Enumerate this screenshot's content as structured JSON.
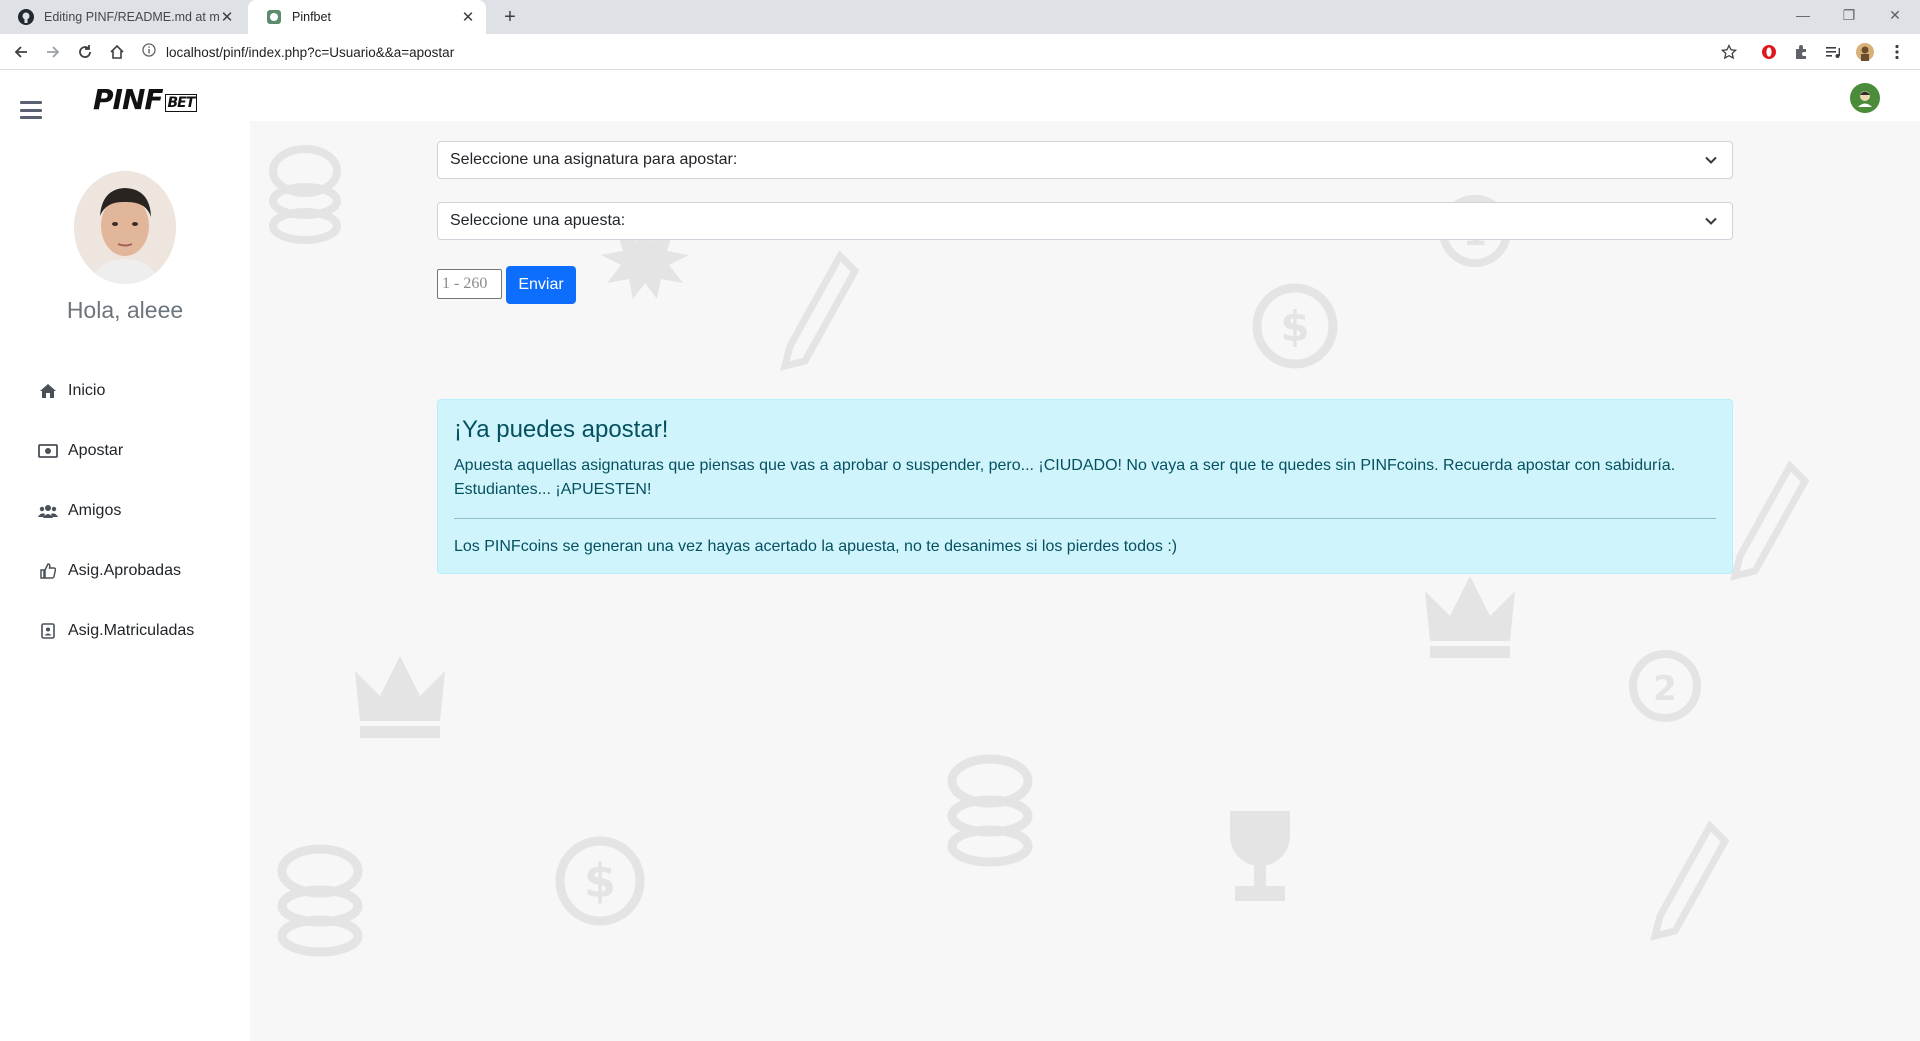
{
  "browser": {
    "tabs": [
      {
        "title": "Editing PINF/README.md at master",
        "icon": "github-icon",
        "active": false
      },
      {
        "title": "Pinfbet",
        "icon": "pinfbet-favicon",
        "active": true
      }
    ],
    "url": "localhost/pinf/index.php?c=Usuario&&a=apostar"
  },
  "app": {
    "logo_main": "PINF",
    "logo_sub": "BET",
    "greeting": "Hola, aleee",
    "menu": [
      {
        "label": "Inicio",
        "icon": "home-icon"
      },
      {
        "label": "Apostar",
        "icon": "money-bill-icon"
      },
      {
        "label": "Amigos",
        "icon": "users-icon"
      },
      {
        "label": "Asig.Aprobadas",
        "icon": "thumbs-up-icon"
      },
      {
        "label": "Asig.Matriculadas",
        "icon": "address-book-icon"
      }
    ]
  },
  "form": {
    "subject_select": "Seleccione una asignatura para apostar:",
    "bet_select": "Seleccione una apuesta:",
    "amount_placeholder": "1 - 260",
    "submit_label": "Enviar"
  },
  "alert": {
    "heading": "¡Ya puedes apostar!",
    "body": "Apuesta aquellas asignaturas que piensas que vas a aprobar o suspender, pero... ¡CIUDADO! No vaya a ser que te quedes sin PINFcoins. Recuerda apostar con sabiduría. Estudiantes... ¡APUESTEN!",
    "footer": "Los PINFcoins se generan una vez hayas acertado la apuesta, no te desanimes si los pierdes todos :)"
  },
  "colors": {
    "primary": "#0d6efd",
    "alert_bg": "#cff4fc",
    "alert_text": "#055160",
    "content_bg": "#f7f7f7"
  }
}
